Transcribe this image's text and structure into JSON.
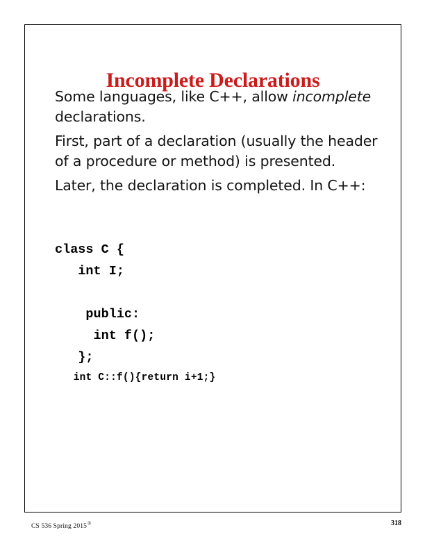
{
  "slide": {
    "title": "Incomplete Declarations",
    "title_color": "#cc1b1b",
    "paragraphs": [
      {
        "id": "p1",
        "runs": [
          {
            "text": "Some languages, like C++, allow ",
            "style": "normal"
          },
          {
            "text": "incomplete",
            "style": "italic"
          },
          {
            "text": " declarations.",
            "style": "normal"
          }
        ],
        "plain": "Some languages, like C++, allow incomplete declarations."
      },
      {
        "id": "p2",
        "runs": [
          {
            "text": "First, part of a declaration (usually the header of a procedure or method) is presented.",
            "style": "normal"
          }
        ],
        "plain": "First, part of a declaration (usually the header of a procedure or method) is presented."
      },
      {
        "id": "p3",
        "runs": [
          {
            "text": "Later, the declaration is completed. In C++:",
            "style": "normal"
          }
        ],
        "plain": "Later, the declaration is completed. In C++:"
      }
    ],
    "code_lines": [
      {
        "text": "class C {",
        "size": "normal"
      },
      {
        "text": "   int I;",
        "size": "normal"
      },
      {
        "text": "",
        "size": "blank"
      },
      {
        "text": "    public:",
        "size": "normal"
      },
      {
        "text": "     int f();",
        "size": "normal"
      },
      {
        "text": "   };",
        "size": "normal"
      },
      {
        "text": "   int C::f(){return i+1;}",
        "size": "small"
      }
    ],
    "footer": {
      "course": "CS 536  Spring 2015",
      "registered_mark": "®"
    },
    "page_number": "318"
  }
}
